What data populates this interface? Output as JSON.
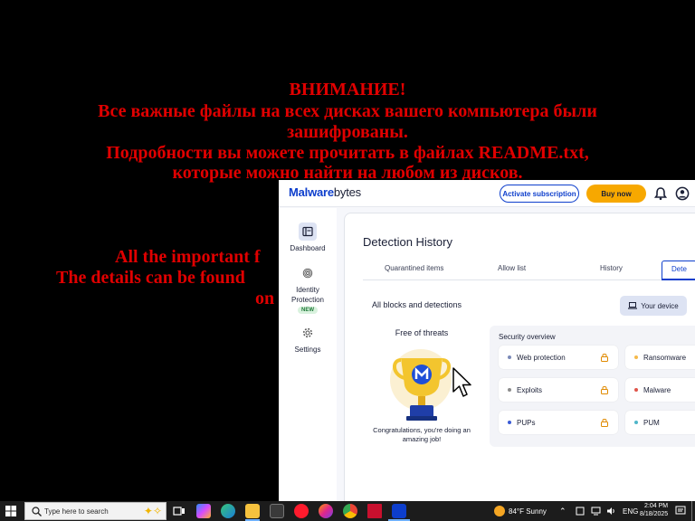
{
  "ransom_note": {
    "lines": [
      "ВНИМАНИЕ!",
      "Все важные файлы на всех дисках вашего компьютера были",
      "зашифрованы.",
      "Подробности вы можете прочитать в файлах README.txt,",
      "которые можно найти на любом из дисков.",
      "All the important f",
      "The details can be found",
      "on"
    ]
  },
  "malwarebytes": {
    "logo_bold": "Malware",
    "logo_thin": "bytes",
    "activate_label": "Activate subscription",
    "buy_label": "Buy now",
    "sidebar": {
      "dashboard": "Dashboard",
      "identity_line1": "Identity",
      "identity_line2": "Protection",
      "new_badge": "NEW",
      "settings": "Settings"
    },
    "page_title": "Detection History",
    "tabs": [
      "Quarantined items",
      "Allow list",
      "History",
      "Dete"
    ],
    "section_title": "All blocks and detections",
    "device_button": "Your device",
    "free_title": "Free of threats",
    "congrats_line1": "Congratulations, you're doing an",
    "congrats_line2": "amazing job!",
    "overview_title": "Security overview",
    "overview_items": [
      {
        "label": "Web protection",
        "color": "#7b8ab8"
      },
      {
        "label": "Ransomware",
        "color": "#f5b94a"
      },
      {
        "label": "Exploits",
        "color": "#8c8c8c"
      },
      {
        "label": "Malware",
        "color": "#e0554a"
      },
      {
        "label": "PUPs",
        "color": "#3b5bd6"
      },
      {
        "label": "PUM",
        "color": "#4fb6c9"
      }
    ]
  },
  "taskbar": {
    "search_placeholder": "Type here to search",
    "weather": "84°F  Sunny",
    "language": "ENG",
    "time": "2:04 PM",
    "date": "8/18/2025"
  },
  "colors": {
    "ransom_red": "#e00000",
    "brand_blue": "#0d3ecc",
    "buy_orange": "#f7a800"
  }
}
